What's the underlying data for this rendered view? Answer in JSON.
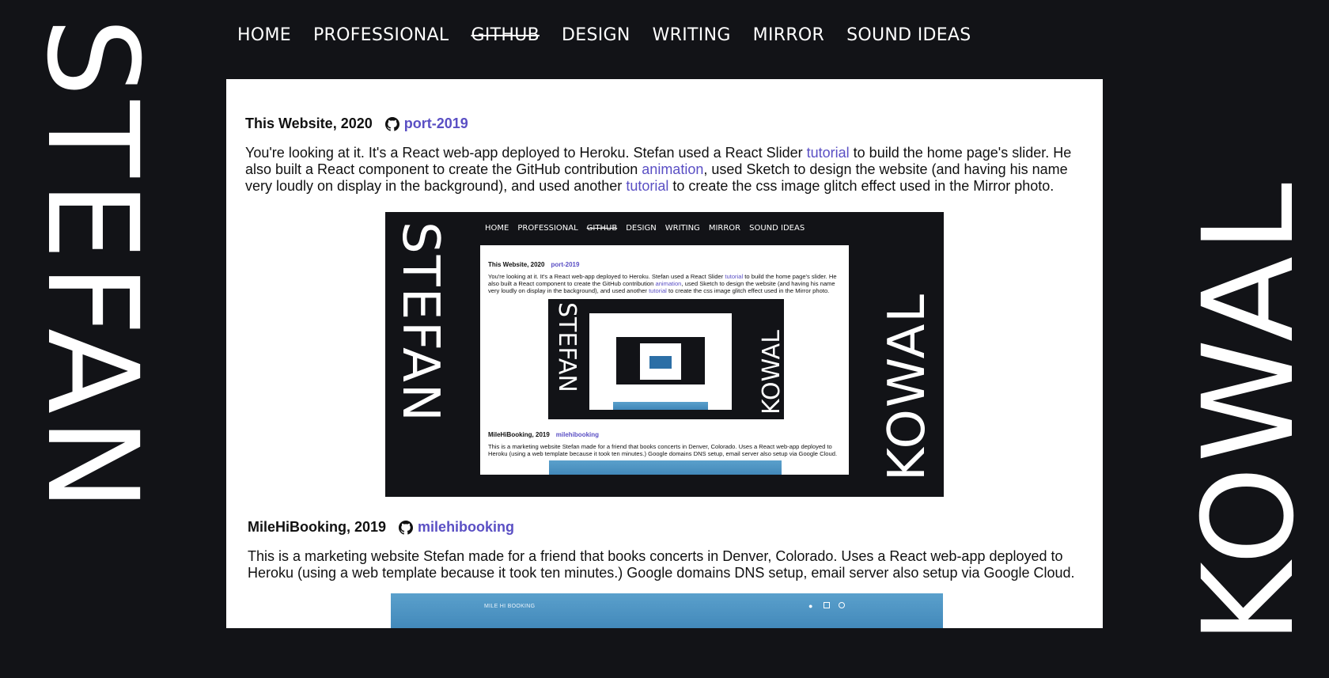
{
  "brand": {
    "first_name": "STEFAN",
    "last_name": "KOWAL"
  },
  "nav": {
    "items": [
      {
        "label": "HOME"
      },
      {
        "label": "PROFESSIONAL"
      },
      {
        "label": "GITHUB"
      },
      {
        "label": "DESIGN"
      },
      {
        "label": "WRITING"
      },
      {
        "label": "MIRROR"
      },
      {
        "label": "SOUND IDEAS"
      }
    ]
  },
  "entries": [
    {
      "title": "This Website, 2020",
      "repo": "port-2019",
      "desc_parts": [
        {
          "text": "You're looking at it. It's a React web-app deployed to Heroku. Stefan used a React Slider ",
          "link": false
        },
        {
          "text": "tutorial",
          "link": true
        },
        {
          "text": " to build the home page's slider. He also built a React component to create the GitHub contribution ",
          "link": false
        },
        {
          "text": "animation",
          "link": true
        },
        {
          "text": ", used Sketch to design the website (and having his name very loudly on display in the background), and used another ",
          "link": false
        },
        {
          "text": "tutorial",
          "link": true
        },
        {
          "text": " to create the css image glitch effect used in the Mirror photo.",
          "link": false
        }
      ]
    },
    {
      "title": "MileHiBooking, 2019",
      "repo": "milehibooking",
      "desc": "This is a marketing website Stefan made for a friend that books concerts in Denver, Colorado. Uses a React web-app deployed to Heroku (using a web template because it took ten minutes.) Google domains DNS setup, email server also setup via Google Cloud."
    }
  ],
  "milehi_preview": {
    "brand": "MILE HI BOOKING"
  },
  "icons": {
    "repo": "github-icon",
    "social": [
      "twitter-icon",
      "facebook-icon",
      "instagram-icon"
    ]
  },
  "colors": {
    "background": "#121317",
    "link": "#5a4fc4",
    "panel": "#ffffff"
  }
}
